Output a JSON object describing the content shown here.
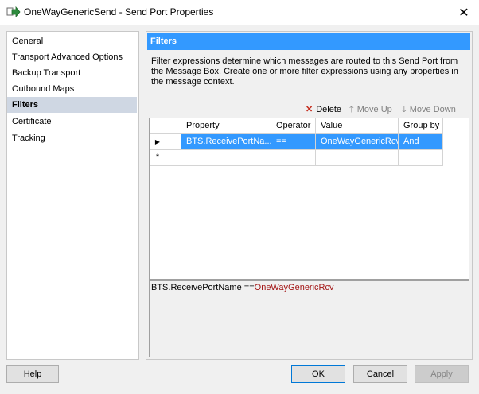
{
  "window": {
    "title": "OneWayGenericSend - Send Port Properties",
    "close_glyph": "✕"
  },
  "nav": {
    "items": [
      {
        "label": "General"
      },
      {
        "label": "Transport Advanced Options"
      },
      {
        "label": "Backup Transport"
      },
      {
        "label": "Outbound Maps"
      },
      {
        "label": "Filters"
      },
      {
        "label": "Certificate"
      },
      {
        "label": "Tracking"
      }
    ],
    "selected": "Filters"
  },
  "panel": {
    "header": "Filters",
    "description": "Filter expressions determine which messages are routed to this Send Port from the Message Box. Create one or more filter expressions using any properties in the message context.",
    "toolbar": {
      "delete_label": "Delete",
      "move_up_label": "Move Up",
      "move_down_label": "Move Down"
    },
    "grid": {
      "columns": [
        "Property",
        "Operator",
        "Value",
        "Group by"
      ],
      "rows": [
        {
          "property": "BTS.ReceivePortNa...",
          "operator": "==",
          "value": "OneWayGenericRcv",
          "group_by": "And"
        }
      ],
      "new_row_marker": "*"
    },
    "expression": {
      "property": "BTS.ReceivePortName",
      "operator": "==",
      "value": "OneWayGenericRcv"
    }
  },
  "buttons": {
    "help": "Help",
    "ok": "OK",
    "cancel": "Cancel",
    "apply": "Apply"
  },
  "colors": {
    "accent": "#3399ff",
    "selected_nav": "#cfd7e3",
    "expression_value": "#a31515"
  }
}
